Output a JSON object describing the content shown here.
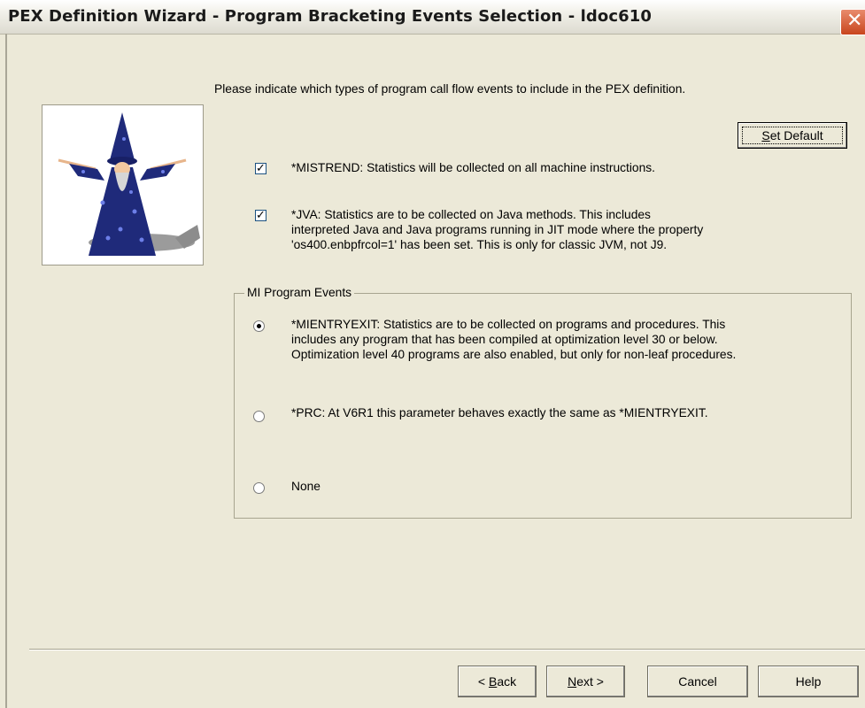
{
  "window": {
    "title": "PEX Definition Wizard - Program Bracketing Events Selection - ldoc610",
    "close_glyph": "✕"
  },
  "intro_text": "Please indicate which types of program call flow events to include in the PEX definition.",
  "set_default": {
    "label_first": "S",
    "label_rest": "et Default"
  },
  "options": {
    "mistrend": {
      "checked": true,
      "check_glyph": "✓",
      "line1": "*MISTREND:  Statistics will be collected on all machine instructions."
    },
    "jva": {
      "checked": true,
      "check_glyph": "✓",
      "line1": "*JVA:  Statistics are to be collected on Java methods. This includes",
      "line2": "interpreted Java and Java programs running in JIT mode where the property",
      "line3": "'os400.enbpfrcol=1' has been set.  This is only for classic JVM, not J9."
    }
  },
  "mi_group": {
    "legend": "MI Program Events",
    "selected": "mientryexit",
    "mientryexit": {
      "line1": "*MIENTRYEXIT: Statistics are to be collected on programs and procedures.  This",
      "line2": "includes any program that has been compiled at optimization level 30 or below.",
      "line3": "Optimization level 40 programs are also enabled, but only for non-leaf procedures."
    },
    "prc": {
      "line1": "*PRC: At V6R1 this parameter behaves exactly the same as *MIENTRYEXIT."
    },
    "none": {
      "line1": "None"
    }
  },
  "nav": {
    "back": {
      "prefix": "< ",
      "mnemonic": "B",
      "rest": "ack"
    },
    "next": {
      "mnemonic": "N",
      "rest": "ext >"
    },
    "cancel": "Cancel",
    "help": "Help"
  },
  "colors": {
    "dialog_bg": "#ece9d8",
    "close_button": "#c8451d",
    "wizard_robe": "#1f2a7a"
  },
  "icons": {
    "wizard_illustration": "wizard-mascot"
  }
}
